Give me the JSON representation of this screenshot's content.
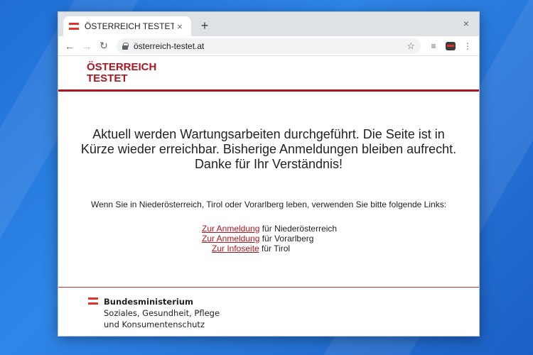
{
  "browser": {
    "tab_title": "ÖSTERREICH TESTET",
    "tab_close": "×",
    "new_tab": "+",
    "window_close": "×",
    "url": "österreich-testet.at",
    "back": "←",
    "forward": "→",
    "reload": "↻",
    "star": "☆",
    "media": "≡",
    "menu": "⋮"
  },
  "header": {
    "logo_line1": "ÖSTERREICH",
    "logo_line2": "TESTET"
  },
  "main": {
    "message": "Aktuell werden Wartungsarbeiten durchgeführt. Die Seite ist in Kürze wieder erreichbar. Bisherige Anmeldungen bleiben aufrecht. Danke für Ihr Verständnis!",
    "sub_message": "Wenn Sie in Niederösterreich, Tirol oder Vorarlberg leben, verwenden Sie bitte folgende Links:",
    "links": [
      {
        "link_text": "Zur Anmeldung",
        "suffix": " für Niederösterreich"
      },
      {
        "link_text": "Zur Anmeldung",
        "suffix": " für Vorarlberg"
      },
      {
        "link_text": "Zur Infoseite",
        "suffix": " für Tirol"
      }
    ]
  },
  "footer": {
    "title": "Bundesministerium",
    "line2": "Soziales, Gesundheit, Pflege",
    "line3": "und Konsumentenschutz"
  },
  "colors": {
    "brand_red": "#b0151e",
    "flag_red": "#e4322b",
    "desktop_blue": "#2f86e8"
  },
  "icons": [
    "austria-flag-icon",
    "lock-icon",
    "star-icon",
    "media-control-icon",
    "extension-icon",
    "kebab-menu-icon"
  ]
}
